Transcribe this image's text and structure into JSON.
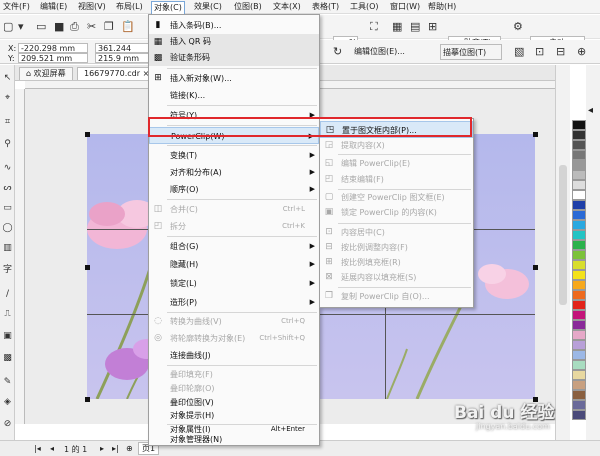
{
  "menubar": {
    "items": [
      "文件(F)",
      "编辑(E)",
      "视图(V)",
      "布局(L)",
      "对象(C)",
      "效果(C)",
      "位图(B)",
      "文本(X)",
      "表格(T)",
      "工具(O)",
      "窗口(W)",
      "帮助(H)"
    ]
  },
  "toolbar": {
    "zoom_value": "%",
    "snap_label": "贴齐(T)",
    "launch_label": "启动"
  },
  "propbar": {
    "x_label": "X:",
    "x_value": "-220.298 mm",
    "y_label": "Y:",
    "y_value": "209.521 mm",
    "w_value": "361.244 mm",
    "h_value": "215.9 mm",
    "edit_bitmap_label": "编辑位图(E)...",
    "trace_bitmap_label": "描摹位图(T)"
  },
  "document": {
    "welcome_tab": "欢迎屏幕",
    "file_tab": "16679770.cdr"
  },
  "statusbar": {
    "page_info": "1 的 1",
    "page_tab": "页1"
  },
  "object_menu": {
    "items": [
      {
        "label": "插入条码(B)...",
        "shortcut": "",
        "arrow": false,
        "disabled": false
      },
      {
        "label": "插入 QR 码",
        "shortcut": "",
        "arrow": false,
        "disabled": false,
        "shaded": true
      },
      {
        "label": "验证条形码",
        "shortcut": "",
        "arrow": false,
        "disabled": false,
        "shaded": true
      },
      {
        "label": "插入新对象(W)...",
        "shortcut": "",
        "arrow": false,
        "disabled": false
      },
      {
        "label": "链接(K)...",
        "shortcut": "",
        "arrow": false,
        "disabled": false
      },
      {
        "label": "符号(Y)",
        "shortcut": "",
        "arrow": true,
        "disabled": false
      },
      {
        "label": "PowerClip(W)",
        "shortcut": "",
        "arrow": true,
        "disabled": false
      },
      {
        "label": "变换(T)",
        "shortcut": "",
        "arrow": true,
        "disabled": false
      },
      {
        "label": "对齐和分布(A)",
        "shortcut": "",
        "arrow": true,
        "disabled": false
      },
      {
        "label": "顺序(O)",
        "shortcut": "",
        "arrow": true,
        "disabled": false
      },
      {
        "label": "合并(C)",
        "shortcut": "Ctrl+L",
        "arrow": false,
        "disabled": true
      },
      {
        "label": "拆分",
        "shortcut": "Ctrl+K",
        "arrow": false,
        "disabled": true
      },
      {
        "label": "组合(G)",
        "shortcut": "",
        "arrow": true,
        "disabled": false
      },
      {
        "label": "隐藏(H)",
        "shortcut": "",
        "arrow": true,
        "disabled": false
      },
      {
        "label": "锁定(L)",
        "shortcut": "",
        "arrow": true,
        "disabled": false
      },
      {
        "label": "造形(P)",
        "shortcut": "",
        "arrow": true,
        "disabled": false
      },
      {
        "label": "转换为曲线(V)",
        "shortcut": "Ctrl+Q",
        "arrow": false,
        "disabled": true
      },
      {
        "label": "将轮廓转换为对象(E)",
        "shortcut": "Ctrl+Shift+Q",
        "arrow": false,
        "disabled": true
      },
      {
        "label": "连接曲线(J)",
        "shortcut": "",
        "arrow": false,
        "disabled": false
      },
      {
        "label": "叠印填充(F)",
        "shortcut": "",
        "arrow": false,
        "disabled": true
      },
      {
        "label": "叠印轮廓(O)",
        "shortcut": "",
        "arrow": false,
        "disabled": true
      },
      {
        "label": "叠印位图(V)",
        "shortcut": "",
        "arrow": false,
        "disabled": false
      },
      {
        "label": "对象提示(H)",
        "shortcut": "",
        "arrow": false,
        "disabled": false
      },
      {
        "label": "对象属性(I)",
        "shortcut": "Alt+Enter",
        "arrow": false,
        "disabled": false
      },
      {
        "label": "对象管理器(N)",
        "shortcut": "",
        "arrow": false,
        "disabled": false
      }
    ]
  },
  "powerclip_menu": {
    "items": [
      {
        "label": "置于图文框内部(P)...",
        "disabled": false
      },
      {
        "label": "提取内容(X)",
        "disabled": true
      },
      {
        "label": "编辑 PowerClip(E)",
        "disabled": true
      },
      {
        "label": "结束编辑(F)",
        "disabled": true
      },
      {
        "label": "创建空 PowerClip 图文框(E)",
        "disabled": true
      },
      {
        "label": "锁定 PowerClip 的内容(K)",
        "disabled": true
      },
      {
        "label": "内容居中(C)",
        "disabled": true
      },
      {
        "label": "按比例调整内容(F)",
        "disabled": true
      },
      {
        "label": "按比例填充框(R)",
        "disabled": true
      },
      {
        "label": "延展内容以填充框(S)",
        "disabled": true
      },
      {
        "label": "复制 PowerClip 自(O)...",
        "disabled": true
      }
    ]
  },
  "watermark": {
    "text": "Bai du 经验",
    "url": "jingyan.baidu.com"
  },
  "colors": {
    "highlight_border": "#e0282c",
    "menu_highlight": "#d9e9f8"
  }
}
